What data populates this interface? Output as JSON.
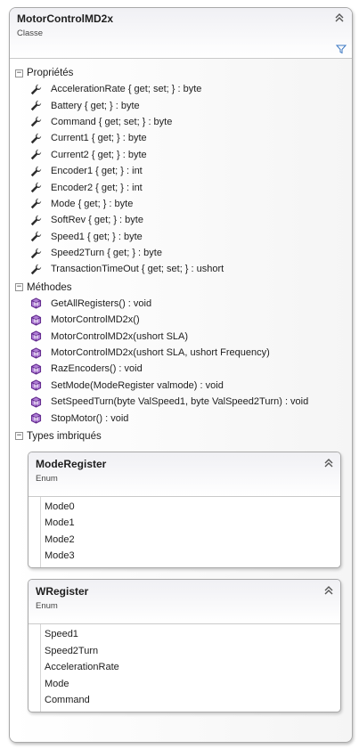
{
  "class": {
    "title": "MotorControlMD2x",
    "subtitle": "Classe",
    "collapse_icon": "chevron-double-up-icon",
    "filter_icon": "filter-icon"
  },
  "properties": {
    "title": "Propriétés",
    "toggle": "−",
    "items": [
      "AccelerationRate { get; set; } : byte",
      "Battery { get; } : byte",
      "Command { get; set; } : byte",
      "Current1 { get; } : byte",
      "Current2 { get; } : byte",
      "Encoder1 { get; } : int",
      "Encoder2 { get; } : int",
      "Mode { get; } : byte",
      "SoftRev { get; } : byte",
      "Speed1 { get; } : byte",
      "Speed2Turn { get; } : byte",
      "TransactionTimeOut { get; set; } : ushort"
    ]
  },
  "methods": {
    "title": "Méthodes",
    "toggle": "−",
    "items": [
      "GetAllRegisters() : void",
      "MotorControlMD2x()",
      "MotorControlMD2x(ushort SLA)",
      "MotorControlMD2x(ushort SLA, ushort Frequency)",
      "RazEncoders() : void",
      "SetMode(ModeRegister valmode) : void",
      "SetSpeedTurn(byte ValSpeed1, byte ValSpeed2Turn) : void",
      "StopMotor() : void"
    ]
  },
  "nested_types": {
    "title": "Types imbriqués",
    "toggle": "−",
    "types": [
      {
        "title": "ModeRegister",
        "subtitle": "Enum",
        "items": [
          "Mode0",
          "Mode1",
          "Mode2",
          "Mode3"
        ]
      },
      {
        "title": "WRegister",
        "subtitle": "Enum",
        "items": [
          "Speed1",
          "Speed2Turn",
          "AccelerationRate",
          "Mode",
          "Command"
        ]
      }
    ]
  },
  "colors": {
    "property_icon": "#2d2d2d",
    "method_icon": "#652d90",
    "method_icon_fill": "#b180d7",
    "filter_icon": "#3c78c3"
  }
}
